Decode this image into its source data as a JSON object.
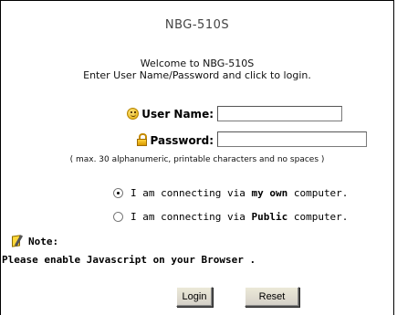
{
  "page": {
    "title": "NBG-510S",
    "welcome_line1": "Welcome to NBG-510S",
    "welcome_line2": "Enter User Name/Password and click to login."
  },
  "login": {
    "username_label": "User Name:",
    "username_value": "",
    "password_label": "Password:",
    "password_value": "",
    "hint": "( max. 30 alphanumeric, printable characters and no spaces )"
  },
  "connection": {
    "options": [
      {
        "prefix": "I am connecting via ",
        "emphasis": "my own",
        "suffix": " computer.",
        "checked": true
      },
      {
        "prefix": "I am connecting via ",
        "emphasis": "Public",
        "suffix": " computer.",
        "checked": false
      }
    ]
  },
  "note": {
    "heading": "Note:",
    "text": "Please enable Javascript on your Browser ."
  },
  "buttons": {
    "login": "Login",
    "reset": "Reset"
  }
}
